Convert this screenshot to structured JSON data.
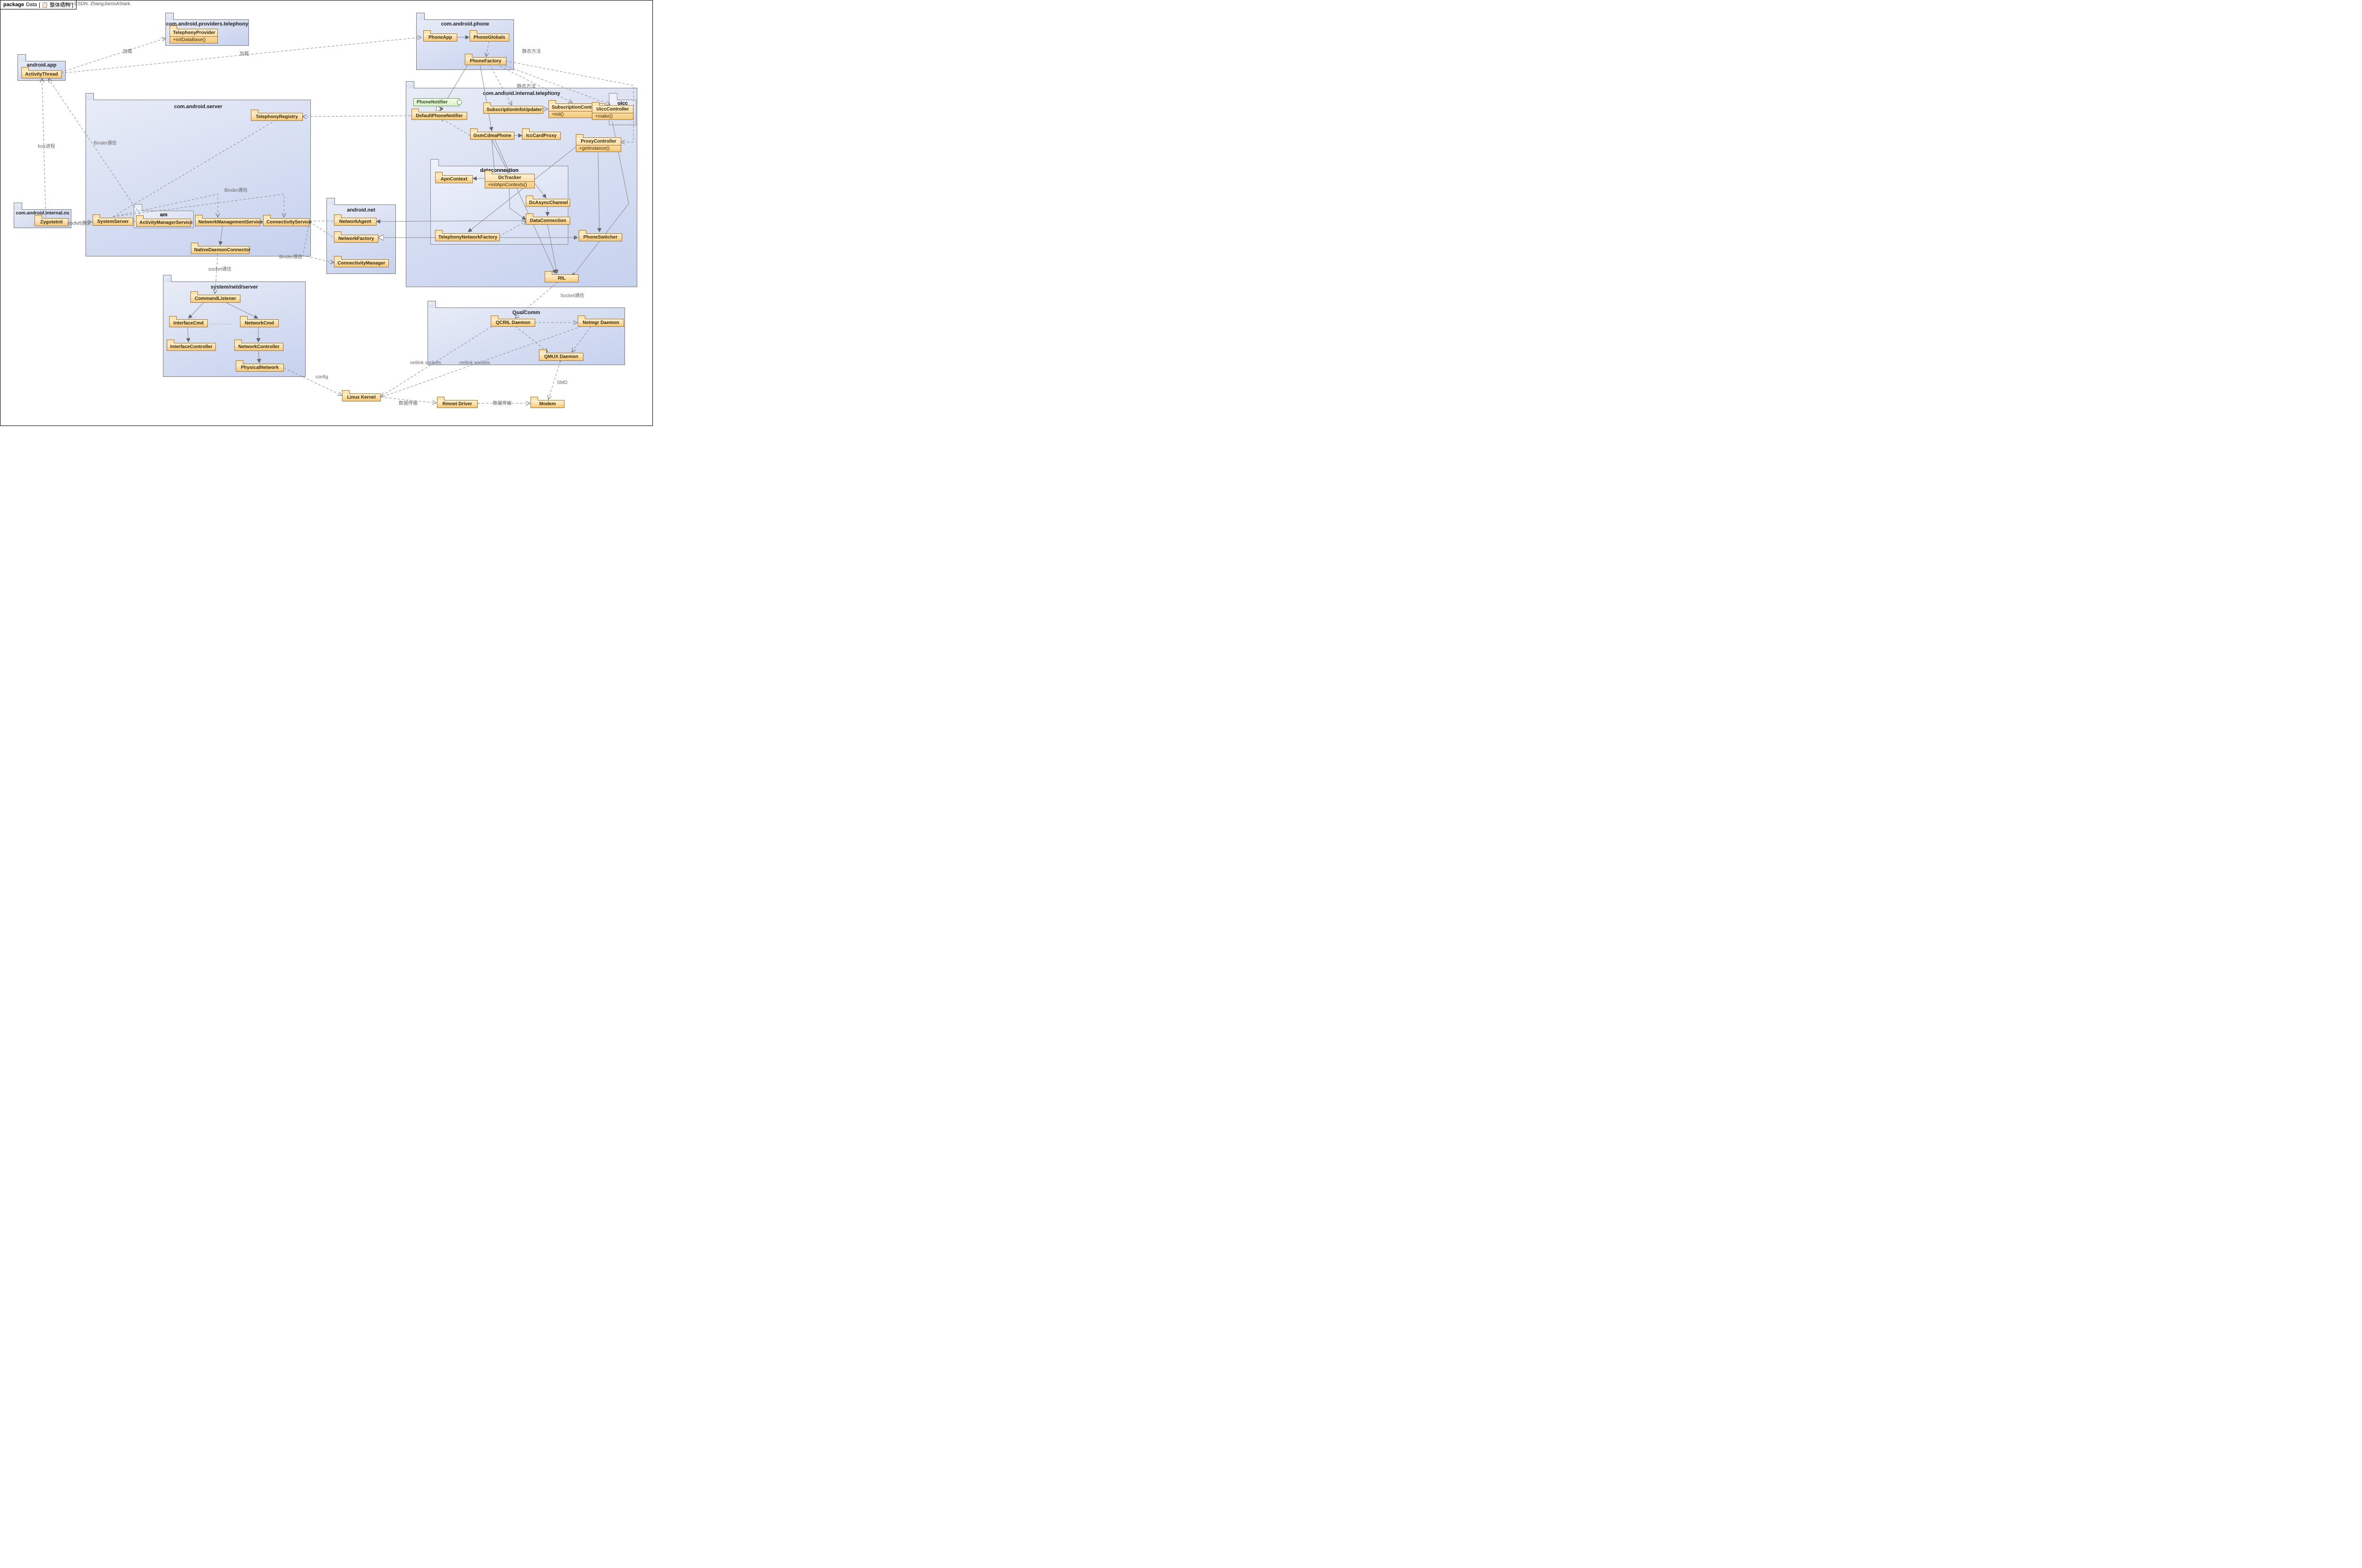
{
  "header": {
    "prefix": "package",
    "name": "Data",
    "breadcrumb": "[ 📋 整体结构 ]"
  },
  "credit": "From CSDN: ZhangJianIsAStark",
  "packages": {
    "providers": {
      "title": "com.android.providers.telephony"
    },
    "phonepkg": {
      "title": "com.android.phone"
    },
    "androidapp": {
      "title": "android.app"
    },
    "internal_os": {
      "title": "com.android.internal.os"
    },
    "server": {
      "title": "com.android.server"
    },
    "am": {
      "title": "am"
    },
    "netd": {
      "title": "system/netd/server"
    },
    "androidnet": {
      "title": "android.net"
    },
    "internal_tel": {
      "title": "com.android.internal.telephony"
    },
    "dataconn": {
      "title": "dataconnection"
    },
    "uicc": {
      "title": "uicc"
    },
    "qualcomm": {
      "title": "QualComm"
    }
  },
  "classes": {
    "TelephonyProvider": {
      "name": "TelephonyProvider",
      "attrs": [
        "+initDataBase()"
      ]
    },
    "PhoneApp": {
      "name": "PhoneApp"
    },
    "PhoneGlobals": {
      "name": "PhoneGlobals"
    },
    "PhoneFactory": {
      "name": "PhoneFactory"
    },
    "ActivityThread": {
      "name": "ActivityThread"
    },
    "ZygoteInit": {
      "name": "ZygoteInit"
    },
    "TelephonyRegistry": {
      "name": "TelephonyRegistry"
    },
    "SystemServer": {
      "name": "SystemServer"
    },
    "ActivityManagerService": {
      "name": "ActivityManagerService"
    },
    "NetworkManagementService": {
      "name": "NetworkManagementService"
    },
    "ConnectivityService": {
      "name": "ConnectivityService"
    },
    "NativeDaemonConnector": {
      "name": "NativeDaemonConnector"
    },
    "CommandListener": {
      "name": "CommandListener"
    },
    "InterfaceCmd": {
      "name": "InterfaceCmd"
    },
    "NetworkCmd": {
      "name": "NetworkCmd"
    },
    "InterfaceController": {
      "name": "InterfaceController"
    },
    "NetworkController": {
      "name": "NetworkController"
    },
    "PhysicalNetwork": {
      "name": "PhysicalNetwork"
    },
    "NetworkAgent": {
      "name": "NetworkAgent"
    },
    "NetworkFactory": {
      "name": "NetworkFactory"
    },
    "ConnectivityManager": {
      "name": "ConnectivityManager"
    },
    "PhoneNotifier": {
      "name": "PhoneNotifier"
    },
    "DefaultPhoneNotifier": {
      "name": "DefaultPhoneNotifier"
    },
    "SubscriptionInfoUpdater": {
      "name": "SubscriptionInfoUpdater"
    },
    "SubscriptionController": {
      "name": "SubscriptionController",
      "attrs": [
        "+init()"
      ]
    },
    "UiccController": {
      "name": "UiccController",
      "attrs": [
        "+make()"
      ]
    },
    "GsmCdmaPhone": {
      "name": "GsmCdmaPhone"
    },
    "IccCardProxy": {
      "name": "IccCardProxy"
    },
    "ProxyController": {
      "name": "ProxyController",
      "attrs": [
        "+getInstance()"
      ]
    },
    "ApnContext": {
      "name": "ApnContext"
    },
    "DcTracker": {
      "name": "DcTracker",
      "attrs": [
        "+initApnContexts()"
      ]
    },
    "DcAsyncChannel": {
      "name": "DcAsyncChannel"
    },
    "DataConnection": {
      "name": "DataConnection"
    },
    "TelephonyNetworkFactory": {
      "name": "TelephonyNetworkFactory"
    },
    "PhoneSwitcher": {
      "name": "PhoneSwitcher"
    },
    "RIL": {
      "name": "RIL"
    },
    "QCRIL": {
      "name": "QCRIL Daemon"
    },
    "Netmgr": {
      "name": "Netmgr Daemon"
    },
    "QMUX": {
      "name": "QMUX Daemon"
    },
    "LinuxKernel": {
      "name": "Linux Kernel"
    },
    "RmnetDriver": {
      "name": "Rmnet Driver"
    },
    "Modem": {
      "name": "Modem"
    }
  },
  "labels": {
    "load1": "加载",
    "load2": "加载",
    "staticm": "静态方法",
    "staticm2": "静态方法",
    "fork": "fork进程",
    "binder1": "Binder通信",
    "binder2": "Binder通信",
    "binder3": "Binder通信",
    "socket1": "socket通信",
    "socket2": "socket通信",
    "socket3": "Socket通信",
    "config": "config",
    "netlink1": "netlink sockets",
    "netlink2": "netlink sockets",
    "smd": "SMD",
    "datax1": "数据传输",
    "datax2": "数据传输"
  }
}
